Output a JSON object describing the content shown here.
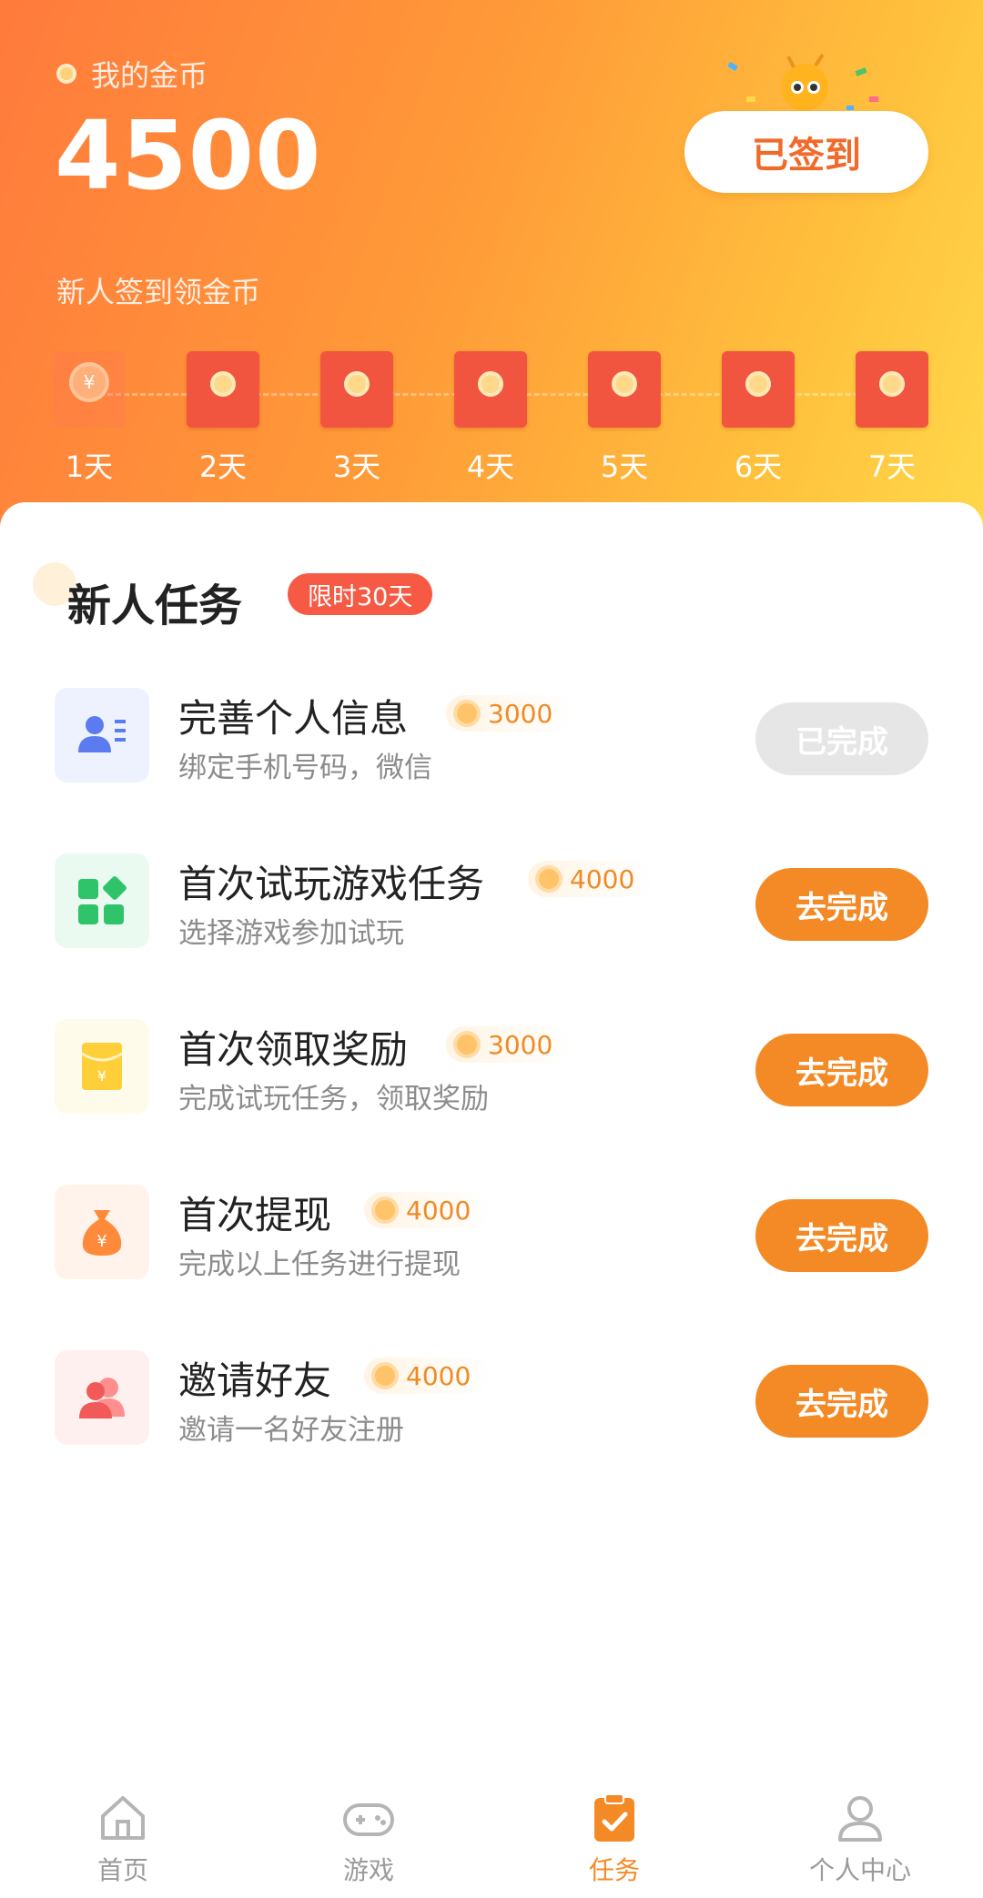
{
  "header": {
    "coin_label": "我的金币",
    "coin_value": "4500",
    "signed_button": "已签到",
    "checkin_title": "新人签到领金币",
    "days": [
      "1天",
      "2天",
      "3天",
      "4天",
      "5天",
      "6天",
      "7天"
    ],
    "done_day_symbol": "¥"
  },
  "section": {
    "title": "新人任务",
    "badge": "限时30天"
  },
  "tasks": [
    {
      "title": "完善个人信息",
      "reward": "3000",
      "desc": "绑定手机号码，微信",
      "button": "已完成",
      "icon": "user-card-icon",
      "done": true
    },
    {
      "title": "首次试玩游戏任务",
      "reward": "4000",
      "desc": "选择游戏参加试玩",
      "button": "去完成",
      "icon": "apps-icon",
      "done": false
    },
    {
      "title": "首次领取奖励",
      "reward": "3000",
      "desc": "完成试玩任务，领取奖励",
      "button": "去完成",
      "icon": "red-envelope-icon",
      "done": false
    },
    {
      "title": "首次提现",
      "reward": "4000",
      "desc": "完成以上任务进行提现",
      "button": "去完成",
      "icon": "money-bag-icon",
      "done": false
    },
    {
      "title": "邀请好友",
      "reward": "4000",
      "desc": "邀请一名好友注册",
      "button": "去完成",
      "icon": "friends-icon",
      "done": false
    }
  ],
  "tabbar": {
    "items": [
      {
        "label": "首页",
        "icon": "home-icon"
      },
      {
        "label": "游戏",
        "icon": "gamepad-icon"
      },
      {
        "label": "任务",
        "icon": "task-icon",
        "active": true
      },
      {
        "label": "个人中心",
        "icon": "person-icon"
      }
    ]
  },
  "colors": {
    "accent": "#f48a25",
    "header_start": "#ff7a3c",
    "header_end": "#ffd84a",
    "badge": "#f75a44",
    "envelope": "#f2553f"
  }
}
